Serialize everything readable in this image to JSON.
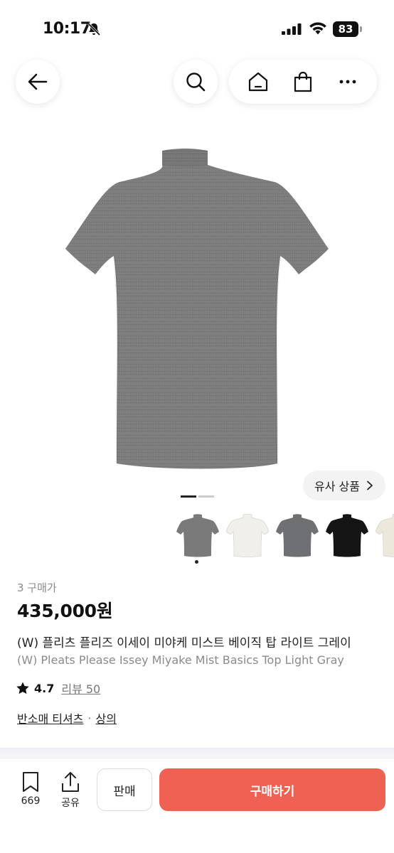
{
  "status_bar": {
    "time": "10:17",
    "battery": "83",
    "icons": [
      "bell-slash-icon",
      "cellular-signal-icon",
      "wifi-icon",
      "battery-icon"
    ]
  },
  "nav": {
    "icons": [
      "arrow-left-icon",
      "search-icon",
      "home-icon",
      "shopping-bag-icon",
      "more-horizontal-icon"
    ]
  },
  "gallery": {
    "similar_products_label": "유사 상품",
    "similar_products_icon": "chevron-right-icon",
    "page_index": 1,
    "page_count": 2,
    "thumbnails": [
      {
        "color": "#7a7a7a",
        "selected": true
      },
      {
        "color": "#f1efea",
        "selected": false
      },
      {
        "color": "#6f7074",
        "selected": false
      },
      {
        "color": "#151515",
        "selected": false
      },
      {
        "color": "#ece9dc",
        "selected": false
      }
    ]
  },
  "product": {
    "purchase_count": "3 구매가",
    "price": "435,000원",
    "title_ko": "(W) 플리츠 플리즈 이세이 미야케 미스트 베이직 탑 라이트 그레이",
    "title_en": "(W) Pleats Please Issey Miyake Mist Basics Top Light Gray",
    "rating": "4.7",
    "review_label": "리뷰 50",
    "category_primary": "반소매 티셔츠",
    "category_separator": "·",
    "category_secondary": "상의"
  },
  "bottom_bar": {
    "bookmark_count": "669",
    "share_label": "공유",
    "sell_label": "판매",
    "buy_label": "구매하기",
    "buy_color": "#ef6253"
  },
  "colors": {
    "accent": "#ef6253",
    "shirt": "#808080"
  }
}
